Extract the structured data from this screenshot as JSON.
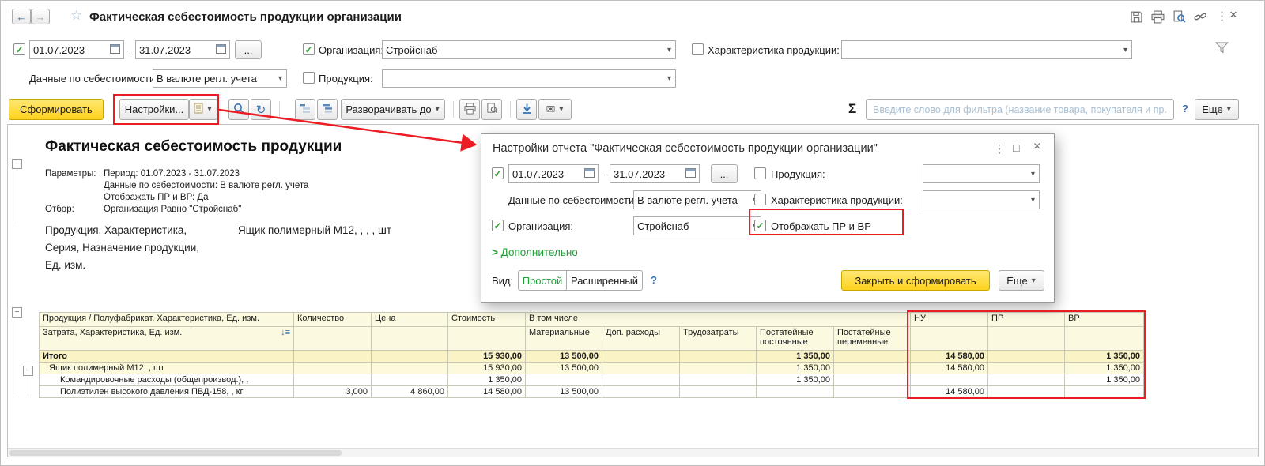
{
  "icons": {
    "back": "←",
    "forward": "→",
    "star": "☆",
    "kebab": "⋮",
    "close": "×",
    "maximize": "□",
    "check": "✓",
    "dropdown": "▾",
    "mail": "✉",
    "refresh": "↻",
    "sigma": "Σ",
    "sort": "↓",
    "collapse": "−",
    "chevron": ">",
    "dash": "–",
    "more_dots": "...",
    "help": "?"
  },
  "window": {
    "title": "Фактическая себестоимость продукции организации"
  },
  "filters": {
    "period_from": "01.07.2023",
    "period_to": "31.07.2023",
    "org_label": "Организация:",
    "org_value": "Стройснаб",
    "char_label": "Характеристика продукции:",
    "cost_label": "Данные по себестоимости:",
    "cost_value": "В валюте регл. учета",
    "prod_label": "Продукция:"
  },
  "toolbar": {
    "generate": "Сформировать",
    "settings": "Настройки...",
    "expand_to": "Разворачивать до",
    "filter_placeholder": "Введите слово для фильтра (название товара, покупателя и пр.)",
    "more": "Еще"
  },
  "report": {
    "title": "Фактическая себестоимость продукции",
    "params_label": "Параметры:",
    "param_period": "Период: 01.07.2023 - 31.07.2023",
    "param_cost": "Данные по себестоимости: В валюте регл. учета",
    "param_prvr": "Отображать ПР и ВР: Да",
    "selection_label": "Отбор:",
    "selection_value": "Организация Равно \"Стройснаб\"",
    "grouping_line1": "Продукция, Характеристика,",
    "grouping_line2": "Серия, Назначение продукции,",
    "grouping_line3": "Ед. изм.",
    "grouping_value": "Ящик полимерный М12, , , , шт"
  },
  "dialog": {
    "title": "Настройки отчета \"Фактическая себестоимость продукции организации\"",
    "period_from": "01.07.2023",
    "period_to": "31.07.2023",
    "cost_label": "Данные по себестоимости:",
    "cost_value": "В валюте регл. учета",
    "org_label": "Организация:",
    "org_value": "Стройснаб",
    "prod_label": "Продукция:",
    "char_label": "Характеристика продукции:",
    "show_prvr_label": "Отображать ПР и ВР",
    "additional_link": "Дополнительно",
    "view_label": "Вид:",
    "view_simple": "Простой",
    "view_extended": "Расширенный",
    "close_generate": "Закрыть и сформировать",
    "more": "Еще"
  },
  "table": {
    "head": {
      "col1_line1": "Продукция / Полуфабрикат, Характеристика, Ед. изм.",
      "col1_line2": "Затрата, Характеристика, Ед. изм.",
      "qty": "Количество",
      "price": "Цена",
      "cost": "Стоимость",
      "including": "В том числе",
      "materials": "Материальные",
      "extra": "Доп. расходы",
      "labor": "Трудозатраты",
      "fixed": "Постатейные постоянные",
      "variable": "Постатейные переменные",
      "nu": "НУ",
      "pr": "ПР",
      "vr": "ВР"
    },
    "rows": [
      {
        "name": "Итого",
        "qty": "",
        "price": "",
        "cost": "15 930,00",
        "materials": "13 500,00",
        "extra": "",
        "labor": "",
        "fixed": "1 350,00",
        "variable": "",
        "nu": "14 580,00",
        "pr": "",
        "vr": "1 350,00"
      },
      {
        "name": "Ящик полимерный М12, , шт",
        "qty": "",
        "price": "",
        "cost": "15 930,00",
        "materials": "13 500,00",
        "extra": "",
        "labor": "",
        "fixed": "1 350,00",
        "variable": "",
        "nu": "14 580,00",
        "pr": "",
        "vr": "1 350,00"
      },
      {
        "name": "Командировочные расходы (общепроизвод.), ,",
        "qty": "",
        "price": "",
        "cost": "1 350,00",
        "materials": "",
        "extra": "",
        "labor": "",
        "fixed": "1 350,00",
        "variable": "",
        "nu": "",
        "pr": "",
        "vr": "1 350,00"
      },
      {
        "name": "Полиэтилен высокого давления ПВД-158, , кг",
        "qty": "3,000",
        "price": "4 860,00",
        "cost": "14 580,00",
        "materials": "13 500,00",
        "extra": "",
        "labor": "",
        "fixed": "",
        "variable": "",
        "nu": "14 580,00",
        "pr": "",
        "vr": ""
      }
    ]
  }
}
